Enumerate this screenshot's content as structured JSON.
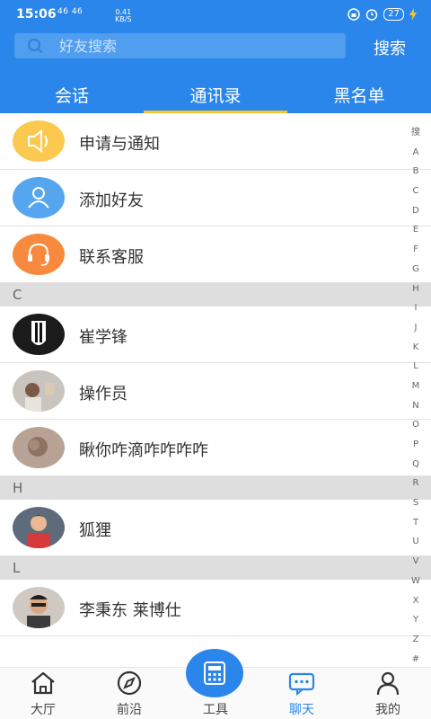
{
  "status": {
    "time": "15:06",
    "signal": "46 46",
    "speed_top": "0.41",
    "speed_bottom": "KB/S",
    "battery": "27"
  },
  "search": {
    "placeholder": "好友搜索",
    "button": "搜索"
  },
  "tabs": [
    {
      "label": "会话",
      "active": false
    },
    {
      "label": "通讯录",
      "active": true
    },
    {
      "label": "黑名单",
      "active": false
    }
  ],
  "fixed_items": [
    {
      "label": "申请与通知",
      "icon": "speaker-icon",
      "color": "#fbc94f"
    },
    {
      "label": "添加好友",
      "icon": "user-icon",
      "color": "#56a6ef"
    },
    {
      "label": "联系客服",
      "icon": "headset-icon",
      "color": "#f78a3e"
    }
  ],
  "sections": [
    {
      "letter": "C",
      "contacts": [
        "崔学锋",
        "操作员",
        "瞅你咋滴咋咋咋咋"
      ]
    },
    {
      "letter": "H",
      "contacts": [
        "狐狸"
      ]
    },
    {
      "letter": "L",
      "contacts": [
        "李秉东 莱博仕"
      ]
    }
  ],
  "index_letters": [
    "搜",
    "A",
    "B",
    "C",
    "D",
    "E",
    "F",
    "G",
    "H",
    "I",
    "J",
    "K",
    "L",
    "M",
    "N",
    "O",
    "P",
    "Q",
    "R",
    "S",
    "T",
    "U",
    "V",
    "W",
    "X",
    "Y",
    "Z",
    "#"
  ],
  "bottom_nav": [
    {
      "label": "大厅",
      "icon": "home-icon"
    },
    {
      "label": "前沿",
      "icon": "compass-icon"
    },
    {
      "label": "工具",
      "icon": "calculator-icon"
    },
    {
      "label": "聊天",
      "icon": "chat-icon",
      "active": true
    },
    {
      "label": "我的",
      "icon": "person-icon"
    }
  ],
  "colors": {
    "primary": "#2a86ea",
    "tab_indicator": "#f7c52c",
    "section_bg": "#dedede"
  }
}
